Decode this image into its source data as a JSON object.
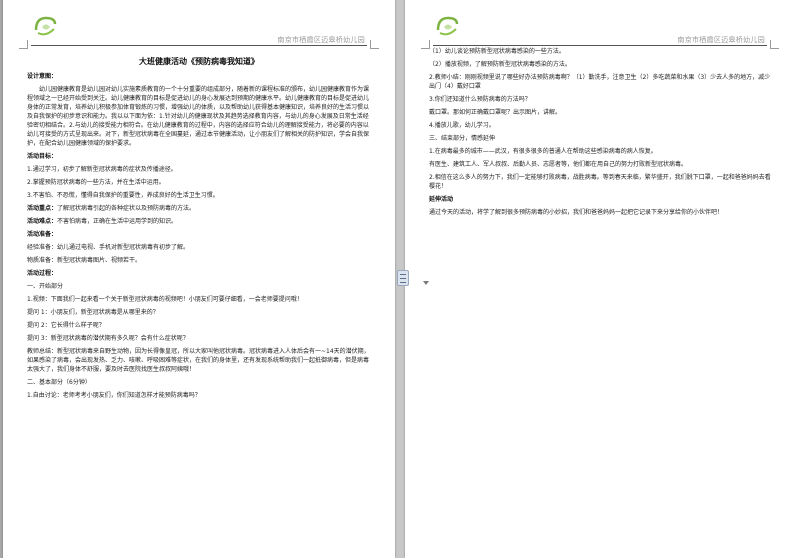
{
  "header": {
    "school": "南京市栖霞区迈皋桥幼儿园"
  },
  "page1": {
    "title": "大班健康活动《预防病毒我知道》",
    "design_label": "设计意图：",
    "design_text": "幼儿园健康教育是幼儿园对幼儿实施素质教育的一个十分重要的组成部分，随着新的课程标准的颁布，幼儿园健康教育作为课程领域之一已经开始受到关注。幼儿健康教育的目标是促进幼儿的身心发展达到预期的健康水平。幼儿健康教育的目标是促进幼儿身体的正常发育，培养幼儿积极参加体育锻炼的习惯，增强幼儿的体质，以及帮助幼儿获得基本健康知识，培养良好的生活习惯以及自我保护的初步意识和能力。我以以下面为依：1.针对幼儿的健康现状及其趋势选择教育内容，与幼儿的身心发展及日常生活经验密切相结合。2.与幼儿的接受能力相符合。在幼儿健康教育的过程中，内容的选择应符合幼儿的理解接受能力，将必要的内容以幼儿可接受的方式呈现出来。对下，新型冠状病毒在全国蔓延，通过本节健康活动，让小朋友们了解相关的防护知识，学会自我保护，在配合幼儿园健康领域的保护要求。",
    "goals_label": "活动目标：",
    "goals": [
      "1.通过学习，初步了解新型冠状病毒的症状及传播途径。",
      "2.掌握预防冠状病毒的一些方法，并在生活中运用。",
      "3.不害怕、不恐慌，懂得自我保护的重要性，养成良好的生活卫生习惯。"
    ],
    "key_label": "活动重点：",
    "key_text": "了解冠状病毒引起的各种症状以及预防病毒的方法。",
    "diff_label": "活动难点：",
    "diff_text": "不害怕病毒，正确在生活中运用学到的知识。",
    "prep_label": "活动准备：",
    "prep_items": [
      "经验准备：幼儿通过电视、手机对新型冠状病毒有初步了解。",
      "物质准备：新型冠状病毒图片、视频若干。"
    ],
    "process_label": "活动过程：",
    "part1_label": "一、开始部分",
    "part1_items": [
      "1.视频：下面我们一起来看一个关于新型冠状病毒的视频吧！小朋友们可要仔细看，一会老师要提问哦！",
      "提问 1：小朋友们，新型冠状病毒是从哪里来的？",
      "提问 2：它长得什么样子呢？",
      "提问 3：新型冠状病毒的潜伏期有多久呢？会有什么症状呢？",
      "教师总结：新型冠状病毒来自野生动物，因为长得像皇冠，所以大家叫他冠状病毒。冠状病毒进入人体后会有一~14天的潜伏期，如果感染了病毒，会出现发热、乏力、咳嗽、呼吸困难等症状，在我们的身体里，还有发现系统帮助我们一起抵御病毒，但是病毒太强大了，我们身体不舒服，要及时去医院找医生叔叔阿姨哦！"
    ],
    "part2_label": "二、基本部分（6分钟）",
    "part2_item": "1.自由讨论：老师考考小朋友们，你们知道怎样才能预防病毒吗？"
  },
  "page2": {
    "lines": [
      "（1）幼儿谈论预防新型冠状病毒感染的一些方法。",
      "（2）播放视频，了解预防新型冠状病毒感染的方法。",
      "2.教师小结：刚刚视频里说了哪些好办法预防病毒啊？（1）勤洗手，注意卫生（2）多吃蔬菜和水果（3）少去人多的地方，减少出门（4）戴好口罩",
      "3.你们还知道什么预防病毒的方法吗？",
      "戴口罩。那如何正确戴口罩呢？出示图片，讲解。",
      "4.播放儿歌，幼儿学习。",
      "三、结束部分，情感延伸",
      "1.在病毒最多的城市——武汉，有很多很多的普通人在帮助这些感染病毒的病人恢复。",
      "有医生、建筑工人、军人叔叔、后勤人员、志愿者等，他们都在用自己的努力打败新型冠状病毒。",
      "2.相信在这么多人的努力下，我们一定能够打败病毒，战胜病毒。等到春天来临，繁华盛开，我们脱下口罩，一起和爸爸妈妈去看樱花！"
    ],
    "ext_label": "延伸活动",
    "ext_text": "通过今天的活动，将学了解到很多预防病毒的小妙招，我们和爸爸妈妈一起把它记录下来分享给你的小伙伴吧！"
  }
}
